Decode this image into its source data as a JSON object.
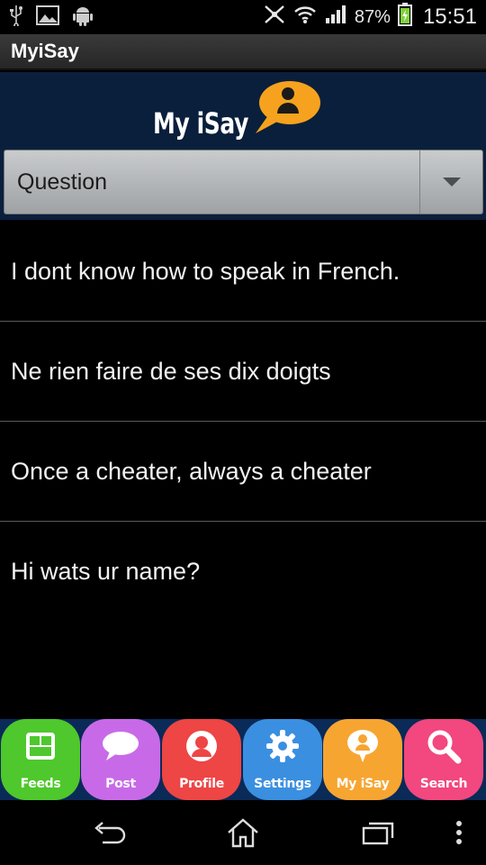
{
  "status_bar": {
    "battery_percent": "87%",
    "time": "15:51",
    "icons": [
      "usb-icon",
      "image-icon",
      "android-icon",
      "mute-icon",
      "wifi-icon",
      "signal-icon",
      "battery-icon"
    ]
  },
  "action_bar": {
    "title": "MyiSay"
  },
  "header": {
    "logo_text": "My iSay",
    "spinner": {
      "selected": "Question"
    }
  },
  "list": {
    "items": [
      "I dont know how to speak in French.",
      "Ne rien faire de ses dix doigts",
      "Once a cheater, always a cheater",
      "Hi wats ur name?"
    ]
  },
  "tabs": [
    {
      "label": "Feeds",
      "color": "#4ec82c",
      "icon": "feeds-icon"
    },
    {
      "label": "Post",
      "color": "#c86ae8",
      "icon": "chat-bubble-icon"
    },
    {
      "label": "Profile",
      "color": "#ee4545",
      "icon": "profile-icon"
    },
    {
      "label": "Settings",
      "color": "#3a8fe0",
      "icon": "gear-icon"
    },
    {
      "label": "My iSay",
      "color": "#f7a531",
      "icon": "myisay-icon"
    },
    {
      "label": "Search",
      "color": "#f2477f",
      "icon": "search-icon"
    }
  ],
  "nav_bar": {
    "buttons": [
      "back-icon",
      "home-icon",
      "recents-icon",
      "menu-icon"
    ]
  }
}
